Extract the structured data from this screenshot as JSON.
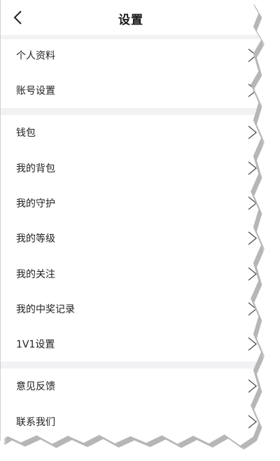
{
  "header": {
    "title": "设置"
  },
  "sections": [
    {
      "items": [
        {
          "label": "个人资料"
        },
        {
          "label": "账号设置"
        }
      ]
    },
    {
      "items": [
        {
          "label": "钱包"
        },
        {
          "label": "我的背包"
        },
        {
          "label": "我的守护"
        },
        {
          "label": "我的等级"
        },
        {
          "label": "我的关注"
        },
        {
          "label": "我的中奖记录"
        },
        {
          "label": "1V1设置"
        }
      ]
    },
    {
      "items": [
        {
          "label": "意见反馈"
        },
        {
          "label": "联系我们"
        }
      ]
    }
  ],
  "icons": {
    "back": "chevron-left-icon",
    "row_arrow": "chevron-right-icon"
  },
  "colors": {
    "separator": "#f2f2f4",
    "text": "#222222",
    "chevron": "#555555"
  }
}
